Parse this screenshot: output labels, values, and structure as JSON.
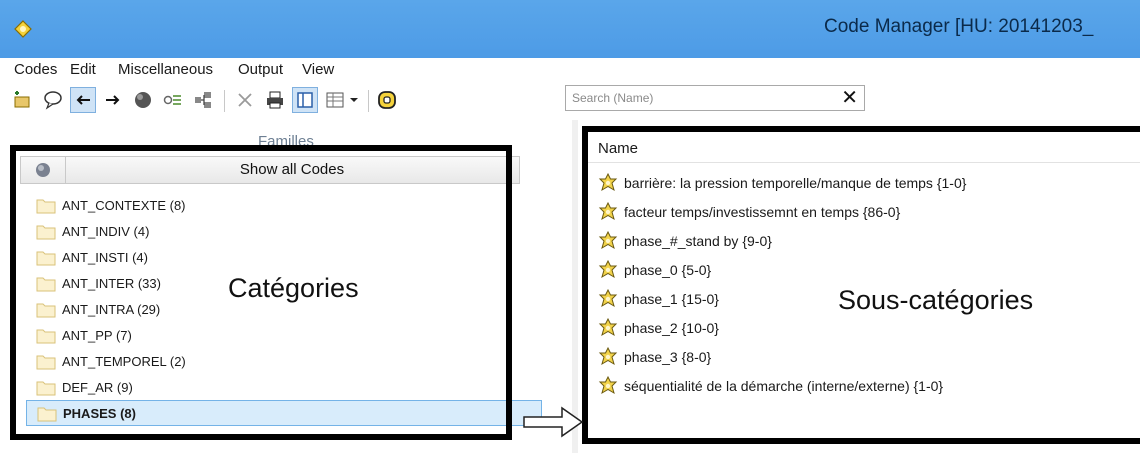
{
  "window": {
    "title": "Code Manager [HU: 20141203_"
  },
  "menu": [
    "Codes",
    "Edit",
    "Miscellaneous",
    "Output",
    "View"
  ],
  "toolbar": {
    "search_placeholder": "Search (Name)",
    "buttons": [
      "new-code-icon",
      "comment-icon",
      "back-arrow-icon",
      "forward-arrow-icon",
      "globe-icon",
      "code-filter-icon",
      "network-icon",
      "delete-icon",
      "print-icon",
      "split-view-icon",
      "table-view-icon",
      "dropdown-icon",
      "code-icon"
    ]
  },
  "left_panel": {
    "title": "Familles",
    "filter_label": "Show all Codes",
    "items": [
      {
        "label": "ANT_CONTEXTE (8)"
      },
      {
        "label": "ANT_INDIV (4)"
      },
      {
        "label": "ANT_INSTI (4)"
      },
      {
        "label": "ANT_INTER (33)"
      },
      {
        "label": "ANT_INTRA (29)"
      },
      {
        "label": "ANT_PP (7)"
      },
      {
        "label": "ANT_TEMPOREL (2)"
      },
      {
        "label": "DEF_AR (9)"
      },
      {
        "label": "PHASES (8)",
        "selected": true
      }
    ]
  },
  "right_panel": {
    "column_name": "Name",
    "items": [
      {
        "label": "barrière: la pression temporelle/manque de temps {1-0}"
      },
      {
        "label": "facteur temps/investissemnt en temps {86-0}"
      },
      {
        "label": "phase_#_stand by {9-0}"
      },
      {
        "label": "phase_0 {5-0}"
      },
      {
        "label": "phase_1 {15-0}"
      },
      {
        "label": "phase_2 {10-0}"
      },
      {
        "label": "phase_3 {8-0}"
      },
      {
        "label": "séquentialité de la démarche (interne/externe) {1-0}"
      }
    ]
  },
  "annotations": {
    "left": "Catégories",
    "right": "Sous-catégories"
  },
  "colors": {
    "titlebar": "#4d9be6",
    "selection": "#d8ecfb",
    "annotation_box": "#000000"
  }
}
